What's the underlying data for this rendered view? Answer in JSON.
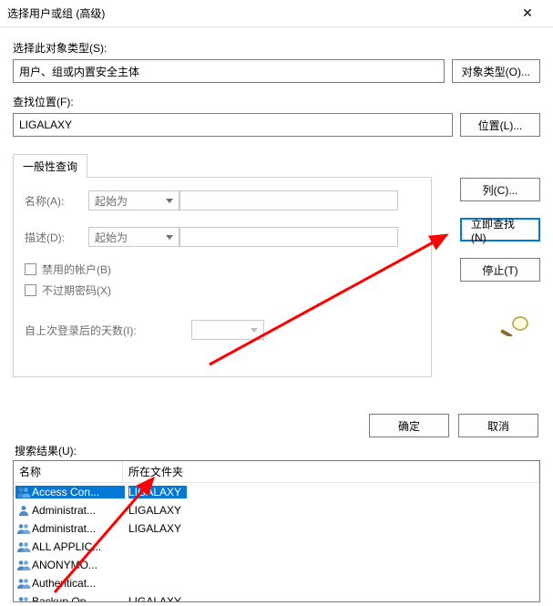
{
  "titlebar": {
    "title": "选择用户或组 (高级)"
  },
  "object_type": {
    "label": "选择此对象类型(S):",
    "value": "用户、组或内置安全主体",
    "button": "对象类型(O)..."
  },
  "location": {
    "label": "查找位置(F):",
    "value": "LIGALAXY",
    "button": "位置(L)..."
  },
  "tab": {
    "label": "一般性查询",
    "name_label": "名称(A):",
    "name_mode": "起始为",
    "desc_label": "描述(D):",
    "desc_mode": "起始为",
    "disabled_accounts": "禁用的帐户(B)",
    "non_expiring": "不过期密码(X)",
    "days_label": "自上次登录后的天数(I):"
  },
  "right_buttons": {
    "columns": "列(C)...",
    "find_now": "立即查找(N)",
    "stop": "停止(T)"
  },
  "footer": {
    "ok": "确定",
    "cancel": "取消"
  },
  "results": {
    "label": "搜索结果(U):",
    "columns": {
      "name": "名称",
      "folder": "所在文件夹"
    },
    "rows": [
      {
        "name": "Access Con...",
        "folder": "LIGALAXY",
        "icon": "group",
        "selected": true
      },
      {
        "name": "Administrat...",
        "folder": "LIGALAXY",
        "icon": "user"
      },
      {
        "name": "Administrat...",
        "folder": "LIGALAXY",
        "icon": "group"
      },
      {
        "name": "ALL APPLIC...",
        "folder": "",
        "icon": "group"
      },
      {
        "name": "ANONYMO...",
        "folder": "",
        "icon": "group"
      },
      {
        "name": "Authenticat...",
        "folder": "",
        "icon": "group"
      },
      {
        "name": "Backup Op...",
        "folder": "LIGALAXY",
        "icon": "group"
      }
    ]
  }
}
